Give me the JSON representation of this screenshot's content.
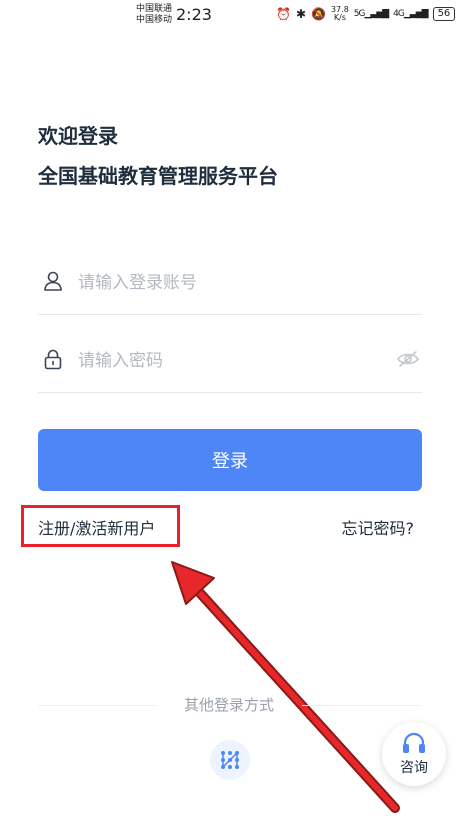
{
  "status_bar": {
    "carrier1": "中国联通",
    "carrier2": "中国移动",
    "time": "2:23",
    "net_speed_value": "37.8",
    "net_speed_unit": "K/s",
    "signal1": "5G",
    "signal2": "4G",
    "battery": "56"
  },
  "header": {
    "welcome": "欢迎登录",
    "subtitle": "全国基础教育管理服务平台"
  },
  "form": {
    "account_placeholder": "请输入登录账号",
    "password_placeholder": "请输入密码",
    "login_label": "登录"
  },
  "links": {
    "register": "注册/激活新用户",
    "forgot": "忘记密码?"
  },
  "other_login": {
    "title": "其他登录方式"
  },
  "consult": {
    "label": "咨询"
  },
  "colors": {
    "primary": "#4f86f7",
    "highlight": "#e8212b"
  }
}
